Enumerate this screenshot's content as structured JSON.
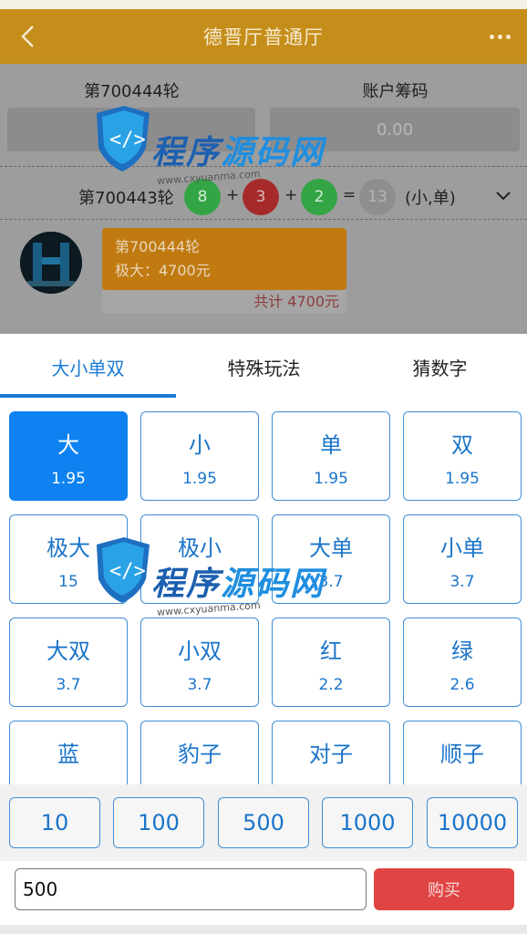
{
  "header": {
    "title": "德晋厅普通厅",
    "back_icon": "chevron-left-icon",
    "more_icon": "more-dots-icon"
  },
  "round": {
    "current_label": "第700444轮",
    "account_label": "账户筹码",
    "account_value": "0.00",
    "previous_label": "第700443轮",
    "balls": [
      "8",
      "3",
      "2"
    ],
    "plus": "+",
    "equals": "=",
    "sum": "13",
    "result": "(小,单)"
  },
  "bet_message": {
    "round": "第700444轮",
    "detail": "极大：4700元",
    "total": "共计 4700元"
  },
  "tabs": [
    {
      "label": "大小单双",
      "active": true
    },
    {
      "label": "特殊玩法",
      "active": false
    },
    {
      "label": "猜数字",
      "active": false
    }
  ],
  "options": [
    {
      "name": "大",
      "odds": "1.95",
      "selected": true
    },
    {
      "name": "小",
      "odds": "1.95"
    },
    {
      "name": "单",
      "odds": "1.95"
    },
    {
      "name": "双",
      "odds": "1.95"
    },
    {
      "name": "极大",
      "odds": "15"
    },
    {
      "name": "极小",
      "odds": ""
    },
    {
      "name": "大单",
      "odds": "3.7"
    },
    {
      "name": "小单",
      "odds": "3.7"
    },
    {
      "name": "大双",
      "odds": "3.7"
    },
    {
      "name": "小双",
      "odds": "3.7"
    },
    {
      "name": "红",
      "odds": "2.2"
    },
    {
      "name": "绿",
      "odds": "2.6"
    },
    {
      "name": "蓝",
      "odds": ""
    },
    {
      "name": "豹子",
      "odds": ""
    },
    {
      "name": "对子",
      "odds": ""
    },
    {
      "name": "顺子",
      "odds": ""
    }
  ],
  "chips": [
    "10",
    "100",
    "500",
    "1000",
    "10000"
  ],
  "amount_input": {
    "value": "500"
  },
  "buy_label": "购买",
  "watermark": {
    "text_a": "程序",
    "text_b": "源码网",
    "url": "www.cxyuanma.com"
  },
  "colors": {
    "header": "#c58e1a",
    "accent_blue": "#1a7bd6",
    "selected": "#0d82f0",
    "buy": "#e14444",
    "ball_green": "#33a544",
    "ball_red": "#a62a2a"
  }
}
